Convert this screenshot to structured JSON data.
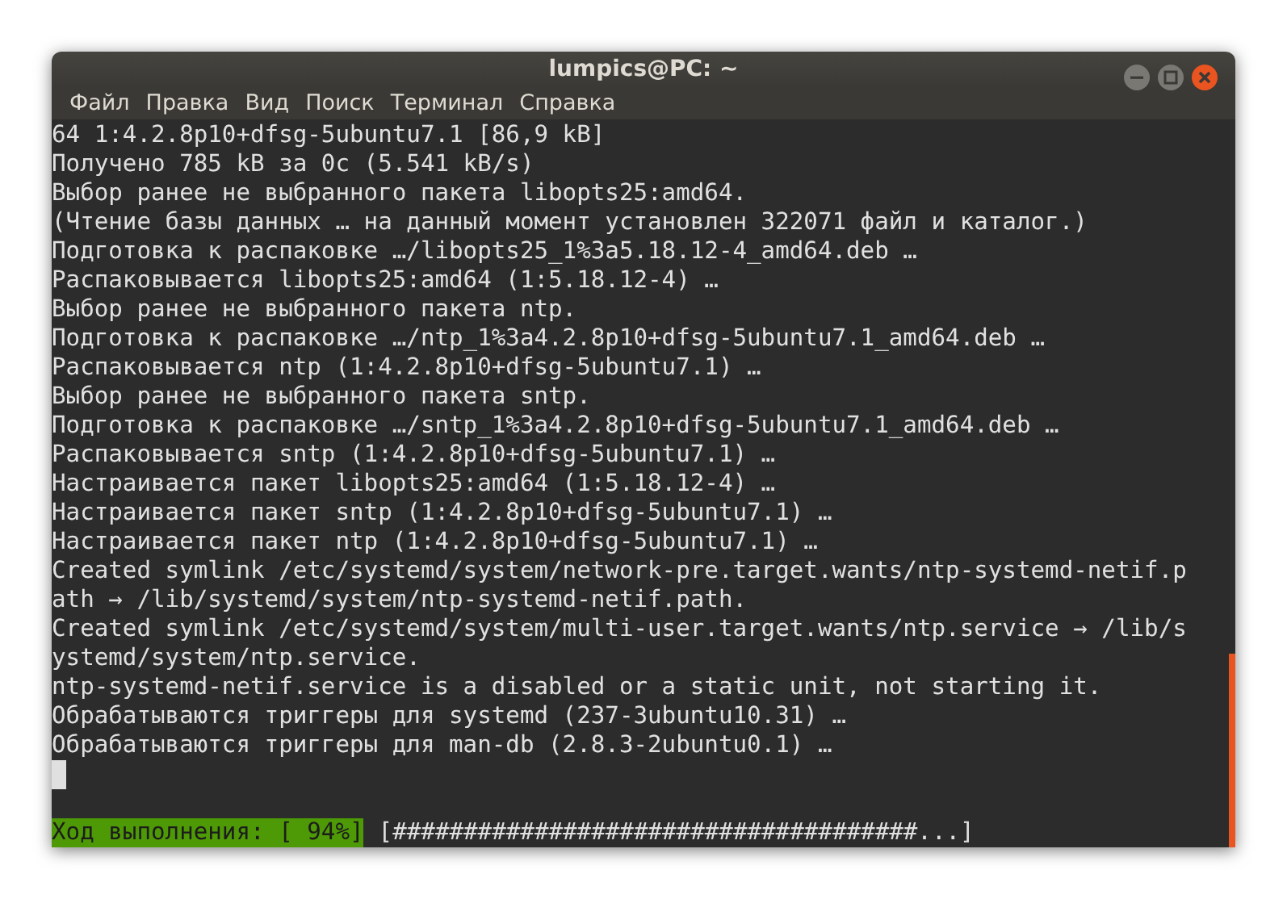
{
  "window": {
    "title": "lumpics@PC: ~"
  },
  "menu": [
    "Файл",
    "Правка",
    "Вид",
    "Поиск",
    "Терминал",
    "Справка"
  ],
  "terminal": {
    "lines": [
      "64 1:4.2.8p10+dfsg-5ubuntu7.1 [86,9 kB]",
      "Получено 785 kB за 0c (5.541 kB/s)",
      "Выбор ранее не выбранного пакета libopts25:amd64.",
      "(Чтение базы данных … на данный момент установлен 322071 файл и каталог.)",
      "Подготовка к распаковке …/libopts25_1%3a5.18.12-4_amd64.deb …",
      "Распаковывается libopts25:amd64 (1:5.18.12-4) …",
      "Выбор ранее не выбранного пакета ntp.",
      "Подготовка к распаковке …/ntp_1%3a4.2.8p10+dfsg-5ubuntu7.1_amd64.deb …",
      "Распаковывается ntp (1:4.2.8p10+dfsg-5ubuntu7.1) …",
      "Выбор ранее не выбранного пакета sntp.",
      "Подготовка к распаковке …/sntp_1%3a4.2.8p10+dfsg-5ubuntu7.1_amd64.deb …",
      "Распаковывается sntp (1:4.2.8p10+dfsg-5ubuntu7.1) …",
      "Настраивается пакет libopts25:amd64 (1:5.18.12-4) …",
      "Настраивается пакет sntp (1:4.2.8p10+dfsg-5ubuntu7.1) …",
      "Настраивается пакет ntp (1:4.2.8p10+dfsg-5ubuntu7.1) …",
      "Created symlink /etc/systemd/system/network-pre.target.wants/ntp-systemd-netif.p",
      "ath → /lib/systemd/system/ntp-systemd-netif.path.",
      "Created symlink /etc/systemd/system/multi-user.target.wants/ntp.service → /lib/s",
      "ystemd/system/ntp.service.",
      "ntp-systemd-netif.service is a disabled or a static unit, not starting it.",
      "Обрабатываются триггеры для systemd (237-3ubuntu10.31) …",
      "Обрабатываются триггеры для man-db (2.8.3-2ubuntu0.1) …"
    ],
    "progress": {
      "label": "Ход выполнения: [ 94%]",
      "bar": "[#####################################...]"
    }
  }
}
